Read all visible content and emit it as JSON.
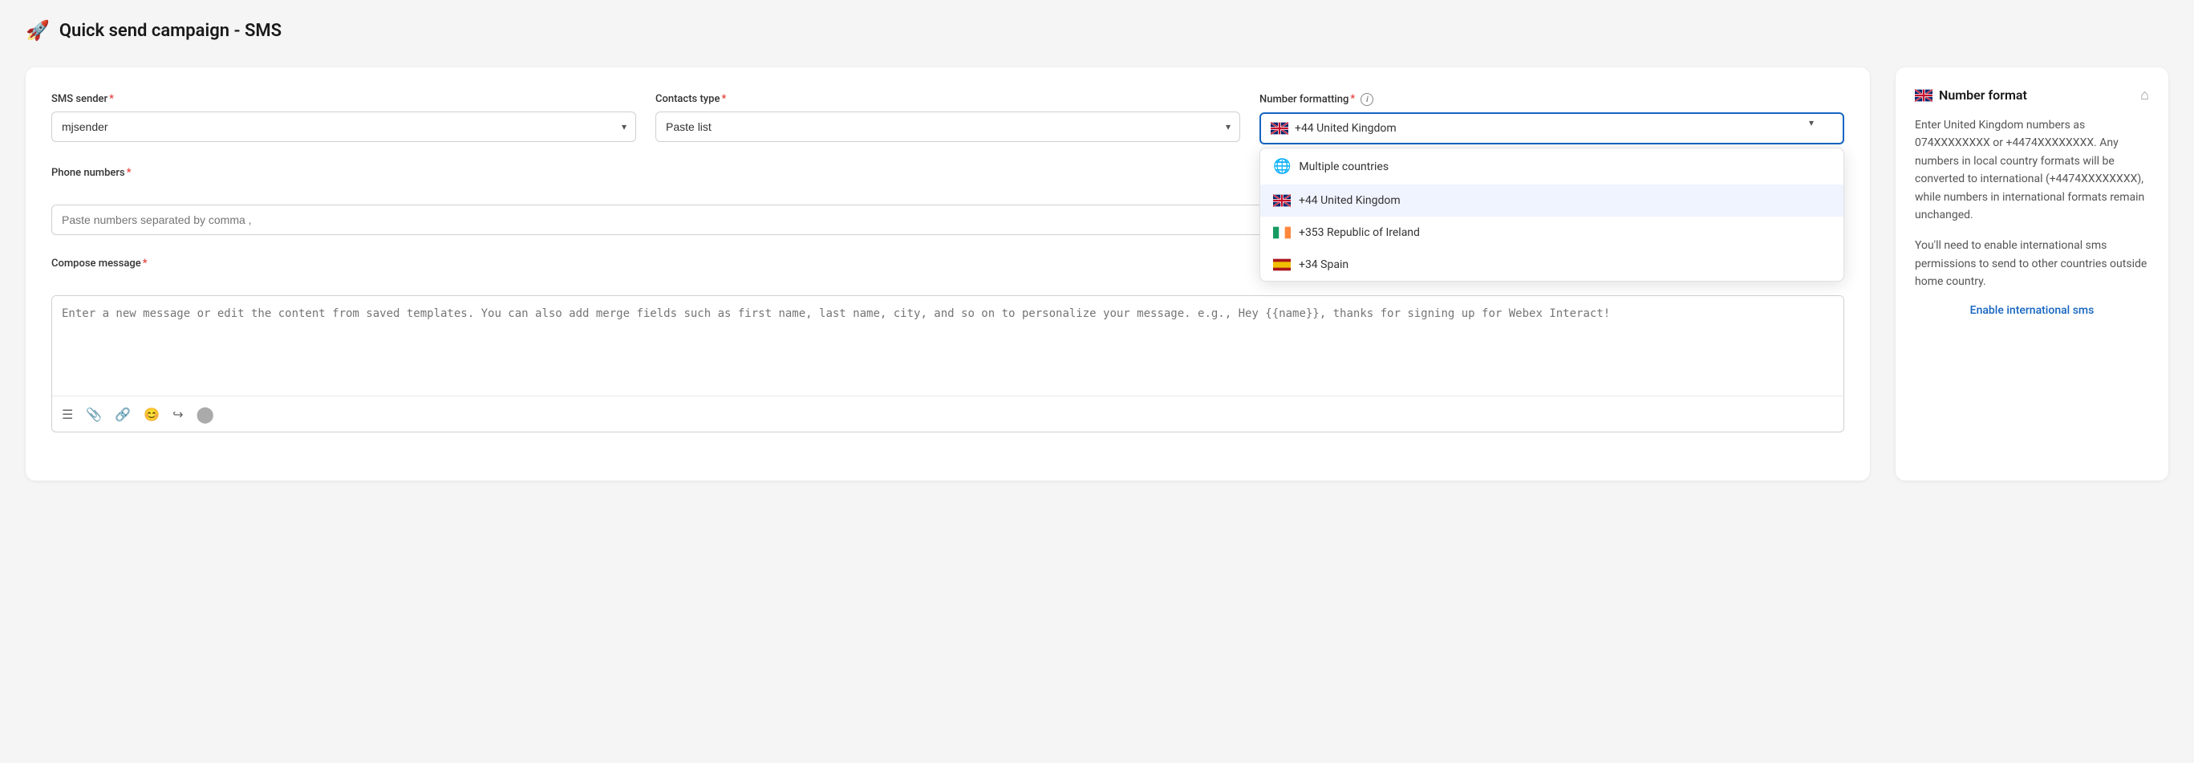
{
  "header": {
    "title": "Quick send campaign - SMS",
    "icon": "🚀"
  },
  "form": {
    "sms_sender": {
      "label": "SMS sender",
      "required": true,
      "value": "mjsender",
      "options": [
        "mjsender"
      ]
    },
    "contacts_type": {
      "label": "Contacts type",
      "required": true,
      "value": "Paste list",
      "options": [
        "Paste list"
      ]
    },
    "number_formatting": {
      "label": "Number formatting",
      "required": true,
      "value": "+44 United Kingdom",
      "info_tooltip": true
    },
    "phone_numbers": {
      "label": "Phone numbers",
      "required": true,
      "placeholder": "Paste numbers separated by comma ,"
    },
    "compose_message": {
      "label": "Compose message",
      "required": true,
      "placeholder": "Enter a new message or edit the content from saved templates. You can also add merge fields such as first name, last name, city, and so on to personalize your message. e.g., Hey {{name}}, thanks for signing up for Webex Interact!"
    }
  },
  "dropdown": {
    "options": [
      {
        "id": "multiple",
        "label": "Multiple countries",
        "flag": "globe"
      },
      {
        "id": "uk",
        "label": "+44 United Kingdom",
        "flag": "uk",
        "selected": true
      },
      {
        "id": "ireland",
        "label": "+353 Republic of Ireland",
        "flag": "ireland"
      },
      {
        "id": "spain",
        "label": "+34 Spain",
        "flag": "spain"
      }
    ]
  },
  "info_panel": {
    "title": "Number format",
    "flag": "uk",
    "home_icon": "⌂",
    "paragraphs": [
      "Enter United Kingdom numbers as 074XXXXXXXX or +4474XXXXXXXX. Any numbers in local country formats will be converted to international (+4474XXXXXXXX), while numbers in international formats remain unchanged.",
      "You'll need to enable international sms permissions to send to other countries outside home country."
    ],
    "link_label": "Enable international sms"
  },
  "toolbar": {
    "icons": [
      {
        "name": "list-icon",
        "symbol": "☰"
      },
      {
        "name": "attach-icon",
        "symbol": "📎"
      },
      {
        "name": "link-icon",
        "symbol": "🔗"
      },
      {
        "name": "emoji-icon",
        "symbol": "😊"
      },
      {
        "name": "arrow-icon",
        "symbol": "↪"
      },
      {
        "name": "circle-icon",
        "symbol": "⬤"
      }
    ]
  }
}
